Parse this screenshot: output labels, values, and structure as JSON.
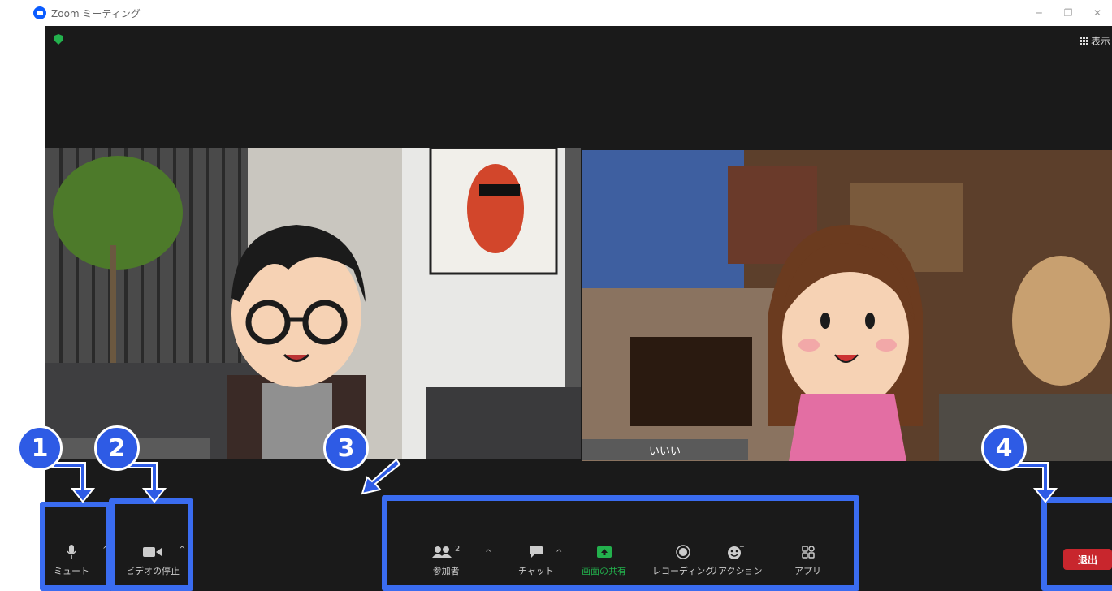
{
  "window": {
    "title": "Zoom ミーティング",
    "view_label": "表示"
  },
  "participants": [
    {
      "name": ""
    },
    {
      "name": "いいい"
    }
  ],
  "toolbar": {
    "mute": "ミュート",
    "video": "ビデオの停止",
    "participants": "参加者",
    "participant_count": "2",
    "chat": "チャット",
    "share": "画面の共有",
    "record": "レコーディング",
    "reactions": "リアクション",
    "apps": "アプリ",
    "leave": "退出"
  },
  "callouts": [
    "1",
    "2",
    "3",
    "4"
  ],
  "colors": {
    "highlight": "#3a6cf0",
    "badge": "#2e5be5",
    "share_green": "#23b14d",
    "leave_red": "#c8262d"
  }
}
